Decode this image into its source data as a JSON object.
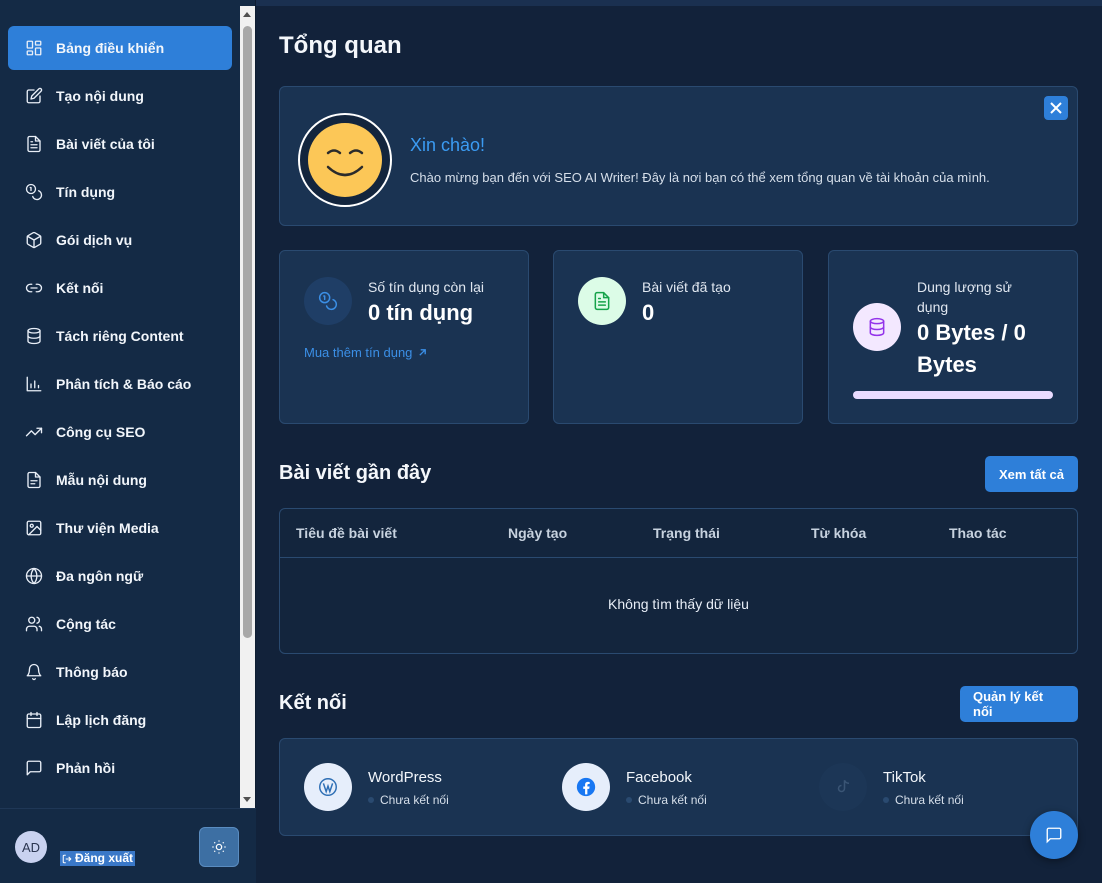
{
  "sidebar": {
    "items": [
      {
        "label": "Bảng điều khiển",
        "icon": "dashboard-icon",
        "active": true
      },
      {
        "label": "Tạo nội dung",
        "icon": "edit-icon"
      },
      {
        "label": "Bài viết của tôi",
        "icon": "document-icon"
      },
      {
        "label": "Tín dụng",
        "icon": "coins-icon"
      },
      {
        "label": "Gói dịch vụ",
        "icon": "package-icon"
      },
      {
        "label": "Kết nối",
        "icon": "link-icon"
      },
      {
        "label": "Tách riêng Content",
        "icon": "database-icon"
      },
      {
        "label": "Phân tích & Báo cáo",
        "icon": "bar-chart-icon"
      },
      {
        "label": "Công cụ SEO",
        "icon": "trending-up-icon"
      },
      {
        "label": "Mẫu nội dung",
        "icon": "template-icon"
      },
      {
        "label": "Thư viện Media",
        "icon": "image-icon"
      },
      {
        "label": "Đa ngôn ngữ",
        "icon": "globe-icon"
      },
      {
        "label": "Cộng tác",
        "icon": "users-icon"
      },
      {
        "label": "Thông báo",
        "icon": "bell-icon"
      },
      {
        "label": "Lập lịch đăng",
        "icon": "calendar-icon"
      },
      {
        "label": "Phản hồi",
        "icon": "message-icon"
      }
    ],
    "footer": {
      "avatar_initials": "AD",
      "logout_label": "Đăng xuất"
    }
  },
  "main": {
    "title": "Tổng quan",
    "welcome": {
      "title": "Xin chào!",
      "text": "Chào mừng bạn đến với SEO AI Writer! Đây là nơi bạn có thể xem tổng quan về tài khoản của mình."
    },
    "stats": [
      {
        "label": "Số tín dụng còn lại",
        "value": "0 tín dụng",
        "link": "Mua thêm tín dụng",
        "icon": "coins-icon"
      },
      {
        "label": "Bài viết đã tạo",
        "value": "0",
        "icon": "file-text-icon"
      },
      {
        "label_line1": "Dung lượng sử",
        "label_line2": "dụng",
        "value_line1": "0 Bytes / 0",
        "value_line2": "Bytes",
        "icon": "database-icon",
        "usage_fraction": 0
      }
    ],
    "recent": {
      "title": "Bài viết gần đây",
      "view_all": "Xem tất cả",
      "columns": [
        "Tiêu đề bài viết",
        "Ngày tạo",
        "Trạng thái",
        "Từ khóa",
        "Thao tác"
      ],
      "empty": "Không tìm thấy dữ liệu"
    },
    "connections": {
      "title": "Kết nối",
      "manage": "Quản lý kết nối",
      "items": [
        {
          "name": "WordPress",
          "status": "Chưa kết nối",
          "icon": "wordpress-icon"
        },
        {
          "name": "Facebook",
          "status": "Chưa kết nối",
          "icon": "facebook-icon"
        },
        {
          "name": "TikTok",
          "status": "Chưa kết nối",
          "icon": "tiktok-icon"
        }
      ]
    }
  },
  "colors": {
    "accent": "#2e7fd9",
    "background": "#12223a",
    "card": "#1a3352",
    "sidebar": "#142a45"
  }
}
